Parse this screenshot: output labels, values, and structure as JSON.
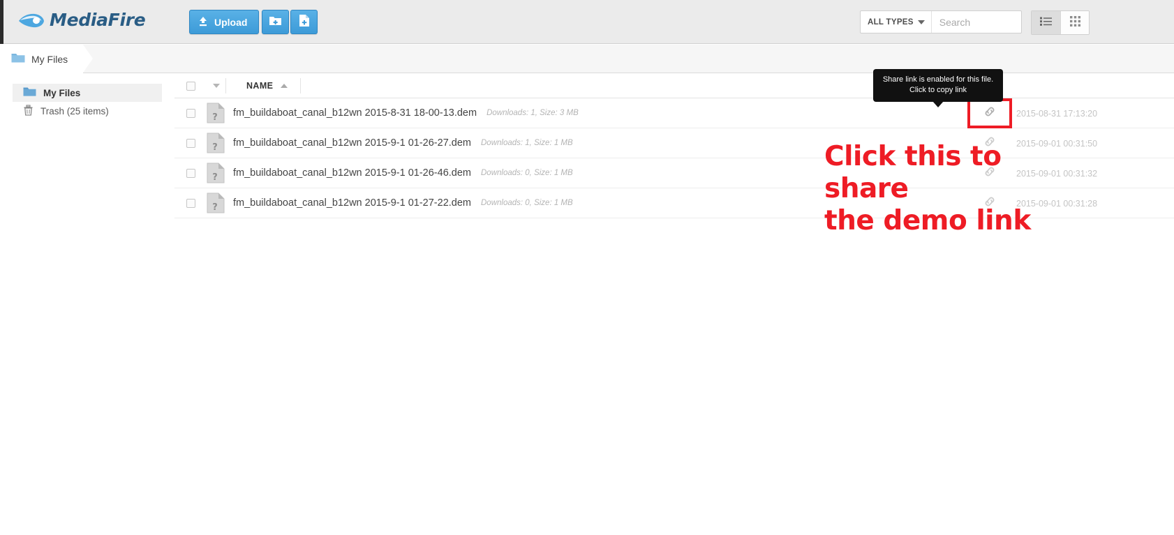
{
  "app": {
    "brand": "MediaFire"
  },
  "toolbar": {
    "upload_label": "Upload",
    "new_folder_label": "",
    "new_file_label": ""
  },
  "search": {
    "types_label": "ALL TYPES",
    "placeholder": "Search",
    "value": ""
  },
  "view": {
    "list_label": "",
    "grid_label": ""
  },
  "breadcrumb": {
    "current": "My Files"
  },
  "sidebar": {
    "items": [
      {
        "label": "My Files"
      },
      {
        "label": "Trash (25 items)"
      }
    ]
  },
  "table": {
    "columns": {
      "name": "NAME"
    },
    "rows": [
      {
        "name": "fm_buildaboat_canal_b12wn 2015-8-31 18-00-13.dem",
        "meta": "Downloads: 1, Size: 3 MB",
        "date": "2015-08-31 17:13:20"
      },
      {
        "name": "fm_buildaboat_canal_b12wn 2015-9-1 01-26-27.dem",
        "meta": "Downloads: 1, Size: 1 MB",
        "date": "2015-09-01 00:31:50"
      },
      {
        "name": "fm_buildaboat_canal_b12wn 2015-9-1 01-26-46.dem",
        "meta": "Downloads: 0, Size: 1 MB",
        "date": "2015-09-01 00:31:32"
      },
      {
        "name": "fm_buildaboat_canal_b12wn 2015-9-1 01-27-22.dem",
        "meta": "Downloads: 0, Size: 1 MB",
        "date": "2015-09-01 00:31:28"
      }
    ]
  },
  "tooltip": {
    "line1": "Share link is enabled for this file.",
    "line2": "Click to copy link"
  },
  "annotation": {
    "line1": "Click this to share",
    "line2": "the demo link"
  },
  "colors": {
    "brand_blue": "#3d9bd8",
    "logo_navy": "#2a5d85",
    "annotation_red": "#ee1c25",
    "tooltip_bg": "#111111"
  }
}
